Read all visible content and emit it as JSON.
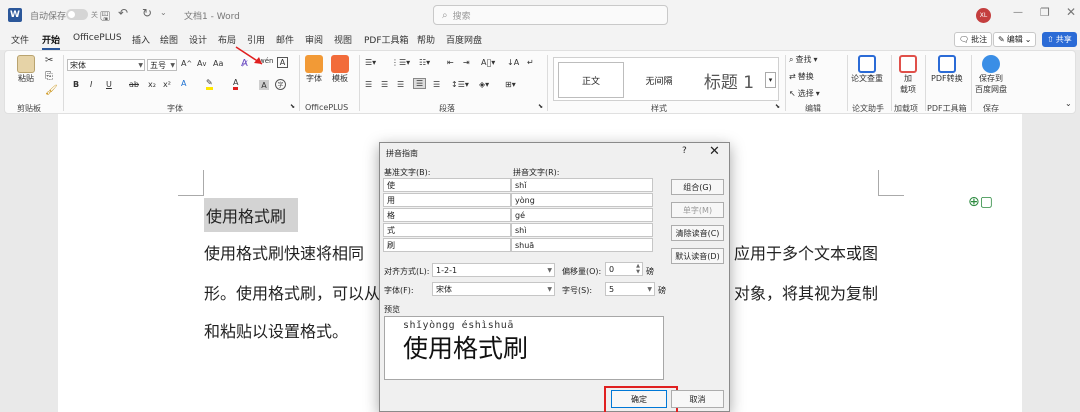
{
  "titlebar": {
    "autosave_label": "自动保存",
    "autosave_state": "关",
    "doc_title": "文档1 - Word",
    "search_placeholder": "搜索",
    "avatar_initials": "XL"
  },
  "menu": {
    "tabs": [
      "文件",
      "开始",
      "OfficePLUS",
      "插入",
      "绘图",
      "设计",
      "布局",
      "引用",
      "邮件",
      "审阅",
      "视图",
      "PDF工具箱",
      "帮助",
      "百度网盘"
    ],
    "active_tab": "开始",
    "comment_btn": "批注",
    "edit_btn": "编辑",
    "share_btn": "共享"
  },
  "ribbon": {
    "paste_label": "粘贴",
    "clipboard_label": "剪贴板",
    "font_name": "宋体",
    "font_size": "五号",
    "font_group_label": "字体",
    "glyph_a": "A",
    "font_btn": "字体",
    "template_btn": "模板",
    "officeplus_label": "OfficePLUS",
    "paragraph_label": "段落",
    "style_normal": "正文",
    "style_nospacing": "无间隔",
    "style_heading1": "标题 1",
    "styles_label": "样式",
    "find_label": "查找",
    "replace_label": "替换",
    "select_label": "选择",
    "editing_label": "编辑",
    "paper_check_btn": "论文查重",
    "paper_group_label": "论文助手",
    "addin_btn_line1": "加",
    "addin_btn_line2": "载项",
    "addin_label": "加载项",
    "pdf_convert_btn": "PDF转换",
    "pdf_label": "PDF工具箱",
    "save_baidu_line1": "保存到",
    "save_baidu_line2": "百度网盘",
    "save_label": "保存"
  },
  "document": {
    "selected_text": "使用格式刷",
    "line1_left": "使用格式刷快速将相同",
    "line1_right": "应用于多个文本或图",
    "line2_left": "形。使用格式刷，可以从",
    "line2_right": "对象，将其视为复制",
    "line3": "和粘贴以设置格式。"
  },
  "dialog": {
    "title": "拼音指南",
    "help": "?",
    "base_label": "基准文字(B):",
    "ruby_label": "拼音文字(R):",
    "rows": [
      {
        "base": "使",
        "ruby": "shǐ"
      },
      {
        "base": "用",
        "ruby": "yòng"
      },
      {
        "base": "格",
        "ruby": "gé"
      },
      {
        "base": "式",
        "ruby": "shì"
      },
      {
        "base": "刷",
        "ruby": "shuā"
      }
    ],
    "btn_group": "组合(G)",
    "btn_mono": "单字(M)",
    "btn_clear": "清除读音(C)",
    "btn_default": "默认读音(D)",
    "align_label": "对齐方式(L):",
    "align_value": "1-2-1",
    "offset_label": "偏移量(O):",
    "offset_value": "0",
    "offset_unit": "磅",
    "font_label": "字体(F):",
    "font_value": "宋体",
    "size_label": "字号(S):",
    "size_value": "5",
    "size_unit": "磅",
    "preview_label": "预览",
    "preview_pinyin": "shǐyòngg éshìshuā",
    "preview_text": "使用格式刷",
    "ok": "确定",
    "cancel": "取消"
  }
}
